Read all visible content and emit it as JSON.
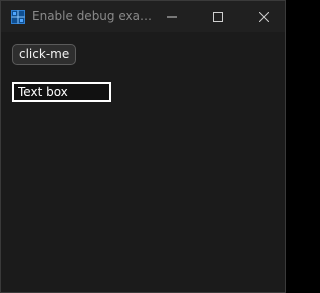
{
  "window": {
    "title": "Enable debug exam...",
    "app_icon": "grid-window-icon"
  },
  "titlebar": {
    "minimize_icon": "minimize-icon",
    "maximize_icon": "maximize-icon",
    "close_icon": "close-icon"
  },
  "content": {
    "button_label": "click-me",
    "textbox_value": "Text box"
  },
  "colors": {
    "window_background": "#1b1b1b",
    "titlebar_background": "#202020",
    "accent_icon": "#2f7fd1",
    "textbox_border": "#ffffff"
  }
}
